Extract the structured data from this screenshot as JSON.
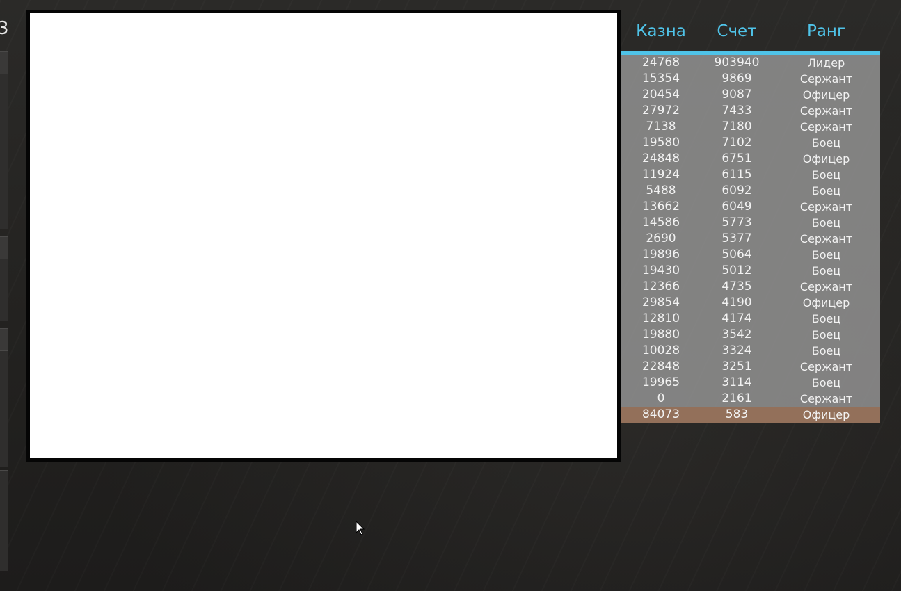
{
  "left_panel": {
    "partial_glyph": "3"
  },
  "members_table": {
    "columns": [
      "Казна",
      "Счет",
      "Ранг"
    ],
    "rows": [
      {
        "kazna": "24768",
        "schet": "903940",
        "rang": "Лидер",
        "highlight": false
      },
      {
        "kazna": "15354",
        "schet": "9869",
        "rang": "Сержант",
        "highlight": false
      },
      {
        "kazna": "20454",
        "schet": "9087",
        "rang": "Офицер",
        "highlight": false
      },
      {
        "kazna": "27972",
        "schet": "7433",
        "rang": "Сержант",
        "highlight": false
      },
      {
        "kazna": "7138",
        "schet": "7180",
        "rang": "Сержант",
        "highlight": false
      },
      {
        "kazna": "19580",
        "schet": "7102",
        "rang": "Боец",
        "highlight": false
      },
      {
        "kazna": "24848",
        "schet": "6751",
        "rang": "Офицер",
        "highlight": false
      },
      {
        "kazna": "11924",
        "schet": "6115",
        "rang": "Боец",
        "highlight": false
      },
      {
        "kazna": "5488",
        "schet": "6092",
        "rang": "Боец",
        "highlight": false
      },
      {
        "kazna": "13662",
        "schet": "6049",
        "rang": "Сержант",
        "highlight": false
      },
      {
        "kazna": "14586",
        "schet": "5773",
        "rang": "Боец",
        "highlight": false
      },
      {
        "kazna": "2690",
        "schet": "5377",
        "rang": "Сержант",
        "highlight": false
      },
      {
        "kazna": "19896",
        "schet": "5064",
        "rang": "Боец",
        "highlight": false
      },
      {
        "kazna": "19430",
        "schet": "5012",
        "rang": "Боец",
        "highlight": false
      },
      {
        "kazna": "12366",
        "schet": "4735",
        "rang": "Сержант",
        "highlight": false
      },
      {
        "kazna": "29854",
        "schet": "4190",
        "rang": "Офицер",
        "highlight": false
      },
      {
        "kazna": "12810",
        "schet": "4174",
        "rang": "Боец",
        "highlight": false
      },
      {
        "kazna": "19880",
        "schet": "3542",
        "rang": "Боец",
        "highlight": false
      },
      {
        "kazna": "10028",
        "schet": "3324",
        "rang": "Боец",
        "highlight": false
      },
      {
        "kazna": "22848",
        "schet": "3251",
        "rang": "Сержант",
        "highlight": false
      },
      {
        "kazna": "19965",
        "schet": "3114",
        "rang": "Боец",
        "highlight": false
      },
      {
        "kazna": "0",
        "schet": "2161",
        "rang": "Сержант",
        "highlight": false
      },
      {
        "kazna": "84073",
        "schet": "583",
        "rang": "Офицер",
        "highlight": true
      }
    ]
  },
  "colors": {
    "accent": "#4fc3e8",
    "row_background": "#969696",
    "highlight_row": "#93705a",
    "row_text": "#f2f2f2",
    "content_window": "#ffffff",
    "content_border": "#050505"
  },
  "icons": {
    "cursor": "mouse-pointer-icon"
  }
}
